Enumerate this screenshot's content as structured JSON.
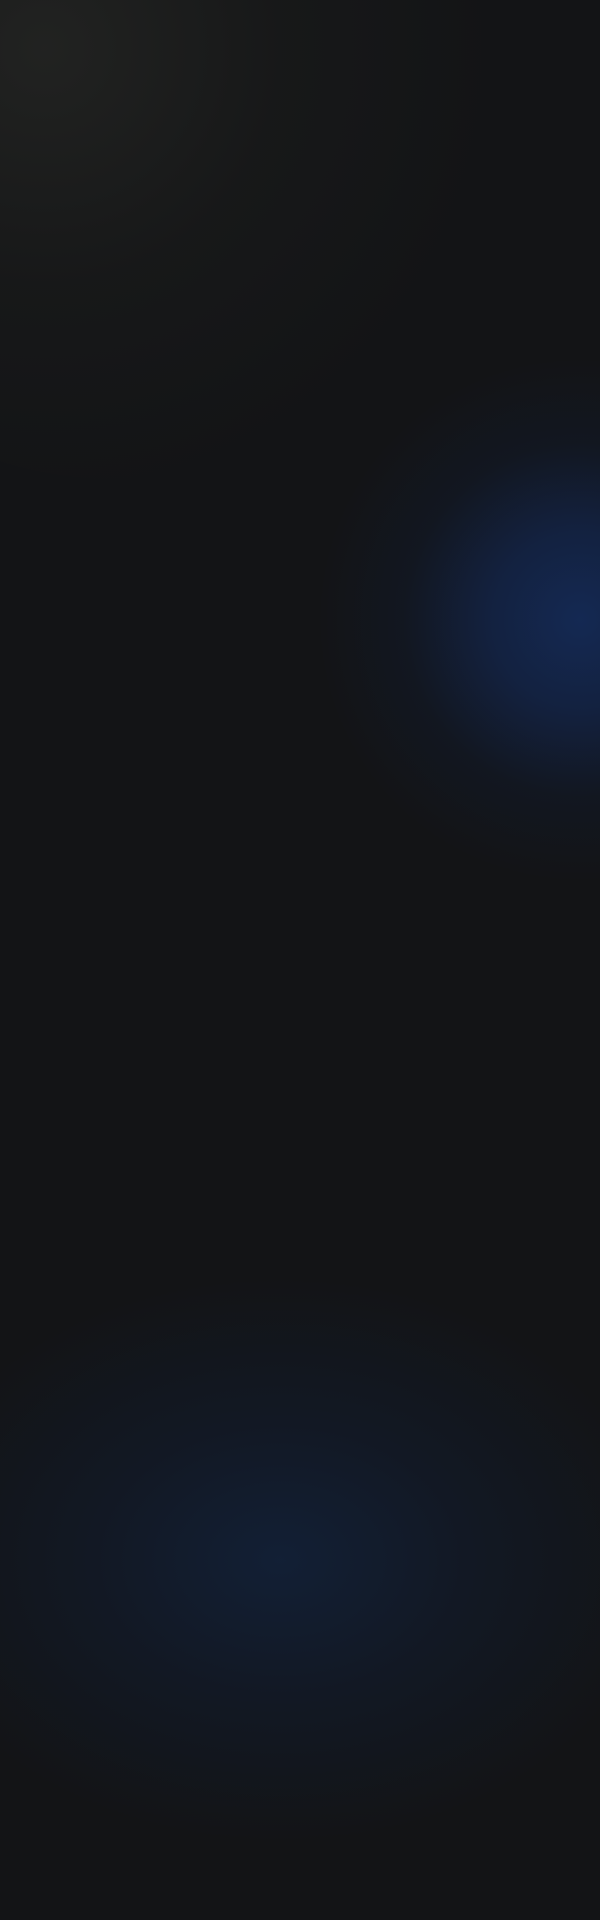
{
  "page": {
    "background_color": "#131416",
    "accent_colors": {
      "top_left_glow": "#242523",
      "right_blue_glow": "#142a56",
      "bottom_blue_glow": "#12223c"
    }
  }
}
